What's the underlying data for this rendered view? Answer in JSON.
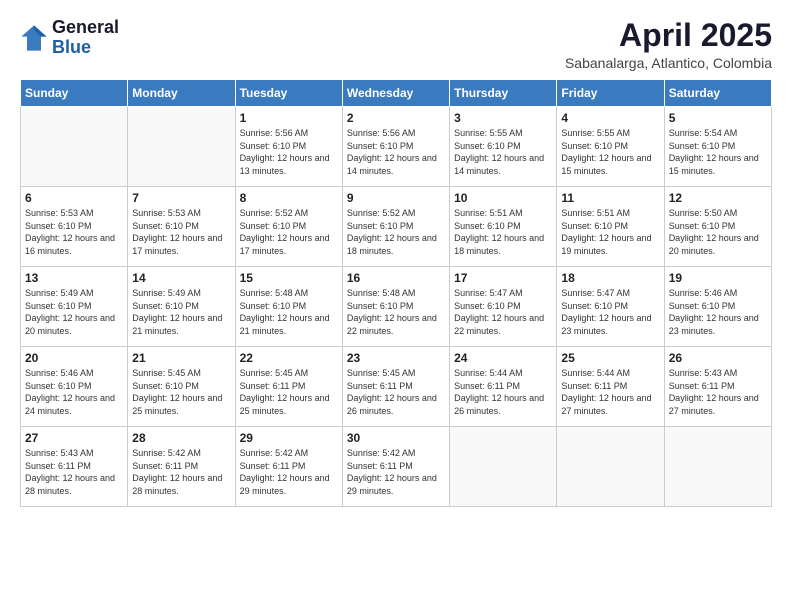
{
  "logo": {
    "general": "General",
    "blue": "Blue"
  },
  "title": {
    "month": "April 2025",
    "location": "Sabanalarga, Atlantico, Colombia"
  },
  "days_of_week": [
    "Sunday",
    "Monday",
    "Tuesday",
    "Wednesday",
    "Thursday",
    "Friday",
    "Saturday"
  ],
  "weeks": [
    [
      {
        "day": "",
        "info": ""
      },
      {
        "day": "",
        "info": ""
      },
      {
        "day": "1",
        "info": "Sunrise: 5:56 AM\nSunset: 6:10 PM\nDaylight: 12 hours and 13 minutes."
      },
      {
        "day": "2",
        "info": "Sunrise: 5:56 AM\nSunset: 6:10 PM\nDaylight: 12 hours and 14 minutes."
      },
      {
        "day": "3",
        "info": "Sunrise: 5:55 AM\nSunset: 6:10 PM\nDaylight: 12 hours and 14 minutes."
      },
      {
        "day": "4",
        "info": "Sunrise: 5:55 AM\nSunset: 6:10 PM\nDaylight: 12 hours and 15 minutes."
      },
      {
        "day": "5",
        "info": "Sunrise: 5:54 AM\nSunset: 6:10 PM\nDaylight: 12 hours and 15 minutes."
      }
    ],
    [
      {
        "day": "6",
        "info": "Sunrise: 5:53 AM\nSunset: 6:10 PM\nDaylight: 12 hours and 16 minutes."
      },
      {
        "day": "7",
        "info": "Sunrise: 5:53 AM\nSunset: 6:10 PM\nDaylight: 12 hours and 17 minutes."
      },
      {
        "day": "8",
        "info": "Sunrise: 5:52 AM\nSunset: 6:10 PM\nDaylight: 12 hours and 17 minutes."
      },
      {
        "day": "9",
        "info": "Sunrise: 5:52 AM\nSunset: 6:10 PM\nDaylight: 12 hours and 18 minutes."
      },
      {
        "day": "10",
        "info": "Sunrise: 5:51 AM\nSunset: 6:10 PM\nDaylight: 12 hours and 18 minutes."
      },
      {
        "day": "11",
        "info": "Sunrise: 5:51 AM\nSunset: 6:10 PM\nDaylight: 12 hours and 19 minutes."
      },
      {
        "day": "12",
        "info": "Sunrise: 5:50 AM\nSunset: 6:10 PM\nDaylight: 12 hours and 20 minutes."
      }
    ],
    [
      {
        "day": "13",
        "info": "Sunrise: 5:49 AM\nSunset: 6:10 PM\nDaylight: 12 hours and 20 minutes."
      },
      {
        "day": "14",
        "info": "Sunrise: 5:49 AM\nSunset: 6:10 PM\nDaylight: 12 hours and 21 minutes."
      },
      {
        "day": "15",
        "info": "Sunrise: 5:48 AM\nSunset: 6:10 PM\nDaylight: 12 hours and 21 minutes."
      },
      {
        "day": "16",
        "info": "Sunrise: 5:48 AM\nSunset: 6:10 PM\nDaylight: 12 hours and 22 minutes."
      },
      {
        "day": "17",
        "info": "Sunrise: 5:47 AM\nSunset: 6:10 PM\nDaylight: 12 hours and 22 minutes."
      },
      {
        "day": "18",
        "info": "Sunrise: 5:47 AM\nSunset: 6:10 PM\nDaylight: 12 hours and 23 minutes."
      },
      {
        "day": "19",
        "info": "Sunrise: 5:46 AM\nSunset: 6:10 PM\nDaylight: 12 hours and 23 minutes."
      }
    ],
    [
      {
        "day": "20",
        "info": "Sunrise: 5:46 AM\nSunset: 6:10 PM\nDaylight: 12 hours and 24 minutes."
      },
      {
        "day": "21",
        "info": "Sunrise: 5:45 AM\nSunset: 6:10 PM\nDaylight: 12 hours and 25 minutes."
      },
      {
        "day": "22",
        "info": "Sunrise: 5:45 AM\nSunset: 6:11 PM\nDaylight: 12 hours and 25 minutes."
      },
      {
        "day": "23",
        "info": "Sunrise: 5:45 AM\nSunset: 6:11 PM\nDaylight: 12 hours and 26 minutes."
      },
      {
        "day": "24",
        "info": "Sunrise: 5:44 AM\nSunset: 6:11 PM\nDaylight: 12 hours and 26 minutes."
      },
      {
        "day": "25",
        "info": "Sunrise: 5:44 AM\nSunset: 6:11 PM\nDaylight: 12 hours and 27 minutes."
      },
      {
        "day": "26",
        "info": "Sunrise: 5:43 AM\nSunset: 6:11 PM\nDaylight: 12 hours and 27 minutes."
      }
    ],
    [
      {
        "day": "27",
        "info": "Sunrise: 5:43 AM\nSunset: 6:11 PM\nDaylight: 12 hours and 28 minutes."
      },
      {
        "day": "28",
        "info": "Sunrise: 5:42 AM\nSunset: 6:11 PM\nDaylight: 12 hours and 28 minutes."
      },
      {
        "day": "29",
        "info": "Sunrise: 5:42 AM\nSunset: 6:11 PM\nDaylight: 12 hours and 29 minutes."
      },
      {
        "day": "30",
        "info": "Sunrise: 5:42 AM\nSunset: 6:11 PM\nDaylight: 12 hours and 29 minutes."
      },
      {
        "day": "",
        "info": ""
      },
      {
        "day": "",
        "info": ""
      },
      {
        "day": "",
        "info": ""
      }
    ]
  ]
}
